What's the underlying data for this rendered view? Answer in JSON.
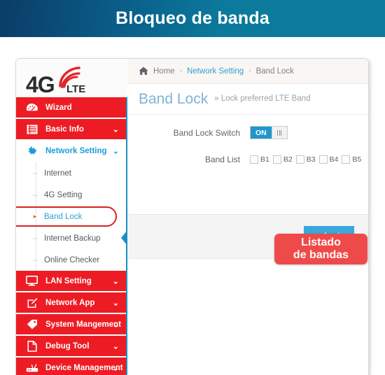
{
  "banner": {
    "title": "Bloqueo de banda",
    "gradient_from": "#0a3c66",
    "gradient_to": "#0b7a9c"
  },
  "logo": {
    "primary": "4G",
    "secondary": "LTE",
    "signal_icon": "wifi-signal-icon",
    "signal_color": "#e3262b"
  },
  "sidebar": {
    "brand_color": "#ed1c24",
    "top_items": [
      {
        "label": "Wizard",
        "icon": "dashboard-icon",
        "caret": "",
        "state": "red"
      },
      {
        "label": "Basic Info",
        "icon": "list-icon",
        "caret": "⌄",
        "state": "red"
      },
      {
        "label": "Network Setting",
        "icon": "gear-icon",
        "caret": "⌄",
        "state": "active"
      }
    ],
    "sub_items": [
      {
        "label": "Internet",
        "bullet": "–",
        "selected": false
      },
      {
        "label": "4G Setting",
        "bullet": "–",
        "selected": false
      },
      {
        "label": "Band Lock",
        "bullet": "▸",
        "selected": true
      },
      {
        "label": "Internet Backup",
        "bullet": "–",
        "selected": false
      },
      {
        "label": "Online Checker",
        "bullet": "–",
        "selected": false
      }
    ],
    "bottom_items": [
      {
        "label": "LAN Setting",
        "icon": "monitor-icon",
        "caret": "⌄"
      },
      {
        "label": "Network App",
        "icon": "edit-icon",
        "caret": "⌄"
      },
      {
        "label": "System Mangement",
        "icon": "tag-icon",
        "caret": "⌄"
      },
      {
        "label": "Debug Tool",
        "icon": "file-icon",
        "caret": "⌄"
      },
      {
        "label": "Device Management",
        "icon": "device-icon",
        "caret": "⌄"
      }
    ]
  },
  "breadcrumb": {
    "home_icon": "home-icon",
    "home": "Home",
    "sep1": "›",
    "section": "Network Setting",
    "sep2": "›",
    "current": "Band Lock"
  },
  "page": {
    "title": "Band Lock",
    "subtitle": "» Lock preferred LTE Band"
  },
  "form": {
    "switch_label": "Band Lock Switch",
    "switch_value": "ON",
    "band_list_label": "Band List",
    "bands": [
      {
        "label": "B1",
        "checked": false
      },
      {
        "label": "B2",
        "checked": false
      },
      {
        "label": "B3",
        "checked": false
      },
      {
        "label": "B4",
        "checked": false
      },
      {
        "label": "B5",
        "checked": false
      }
    ]
  },
  "footer": {
    "apply_label": "Apply",
    "apply_icon": "check-icon",
    "apply_color": "#39a8da"
  },
  "callout": {
    "line1": "Listado",
    "line2": "de bandas",
    "color": "#ef4a4a"
  }
}
